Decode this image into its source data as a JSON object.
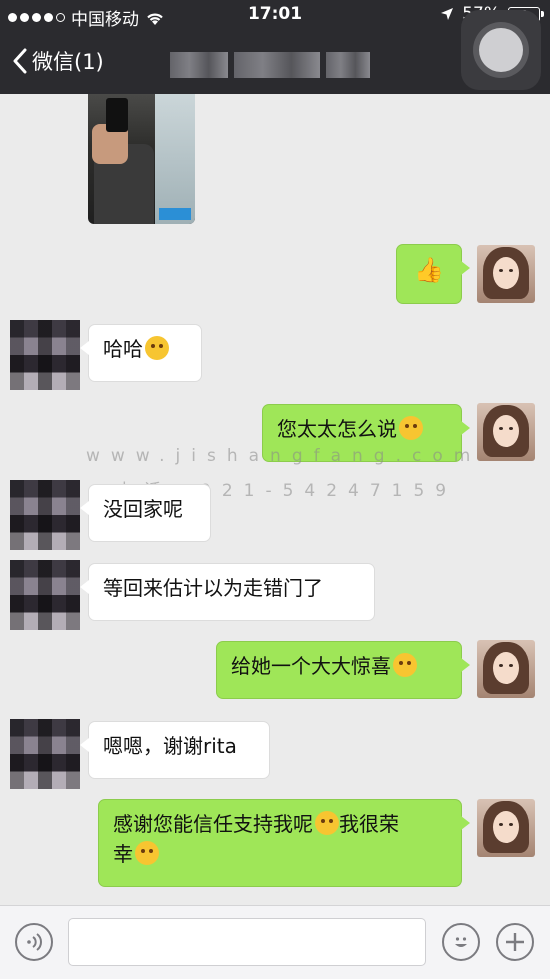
{
  "status_bar": {
    "carrier": "中国移动",
    "time": "17:01",
    "battery_percent": "57%",
    "battery_level": 0.57,
    "icons": [
      "signal-dots-icon",
      "wifi-icon",
      "location-arrow-icon",
      "battery-icon"
    ]
  },
  "nav": {
    "back_label": "微信(1)",
    "back_icon": "chevron-left-icon",
    "title_blurred": true,
    "floating_button_icon": "assistive-touch-icon"
  },
  "watermark": {
    "url": "www.jishangfang.com",
    "phone": "电话：021-54247159"
  },
  "messages": [
    {
      "from": "friend",
      "type": "image",
      "content_icon": "photo-selfie"
    },
    {
      "from": "me",
      "type": "emoji",
      "content_icon": "thumbs-up-icon",
      "glyph": "👍"
    },
    {
      "from": "friend",
      "type": "text",
      "text": "哈哈",
      "emoji": "grin-icon"
    },
    {
      "from": "me",
      "type": "text",
      "text": "您太太怎么说",
      "emoji": "smirk-icon"
    },
    {
      "from": "friend",
      "type": "text",
      "text": "没回家呢"
    },
    {
      "from": "friend",
      "type": "text",
      "text": "等回来估计以为走错门了"
    },
    {
      "from": "me",
      "type": "text",
      "text": "给她一个大大惊喜",
      "emoji": "laugh-icon"
    },
    {
      "from": "friend",
      "type": "text",
      "text": "嗯嗯，谢谢rita"
    },
    {
      "from": "me",
      "type": "text",
      "text_line1": "感谢您能信任支持我呢",
      "emoji1": "blush-icon",
      "text_line1b": "我很荣",
      "text_line2": "幸",
      "emoji2": "flushed-icon"
    }
  ],
  "input_bar": {
    "voice_icon": "voice-icon",
    "input_placeholder": "",
    "emoji_icon": "emoji-face-icon",
    "plus_icon": "plus-icon"
  },
  "colors": {
    "bar_bg": "#2b2b2f",
    "chat_bg": "#ebebeb",
    "my_bubble": "#9fe658",
    "friend_bubble": "#ffffff"
  }
}
